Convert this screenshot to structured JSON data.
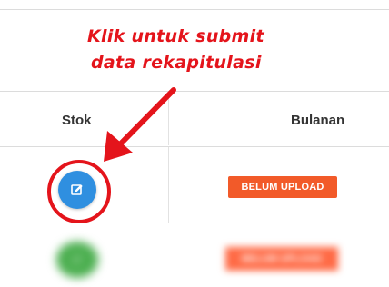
{
  "table": {
    "headers": {
      "stok": "Stok",
      "bulanan": "Bulanan"
    },
    "rows": [
      {
        "stok_action": "edit-icon",
        "bulanan_status": "BELUM UPLOAD"
      },
      {
        "stok_action": "blurred",
        "bulanan_status": "BELUM UPLOAD"
      }
    ]
  },
  "annotation": {
    "line1": "Klik untuk submit",
    "line2": "data rekapitulasi",
    "color": "#e4141b"
  },
  "colors": {
    "edit_button": "#2f8fe0",
    "status_badge": "#f25a29",
    "blurred_button": "#4caf50"
  }
}
